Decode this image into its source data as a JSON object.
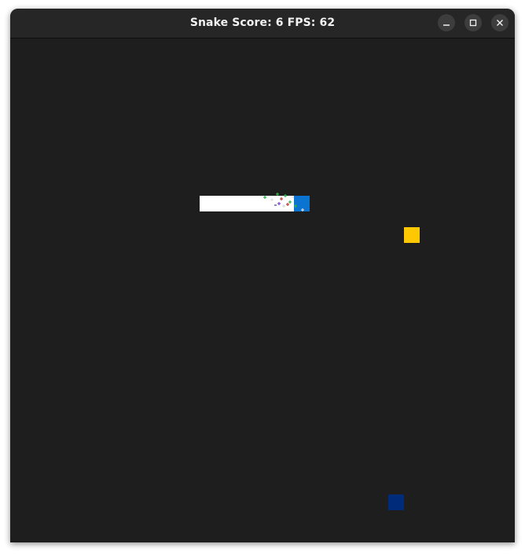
{
  "window": {
    "title": "Snake Score: 6 FPS: 62",
    "controls": {
      "minimize_icon": "minimize-icon",
      "maximize_icon": "maximize-icon",
      "close_icon": "close-icon"
    }
  },
  "game": {
    "score": 6,
    "fps": 62,
    "colors": {
      "background": "#1e1e1e",
      "snake_body": "#ffffff",
      "snake_head": "#0a74d0",
      "food": "#ffc800",
      "obstacle": "#002a7a"
    }
  }
}
